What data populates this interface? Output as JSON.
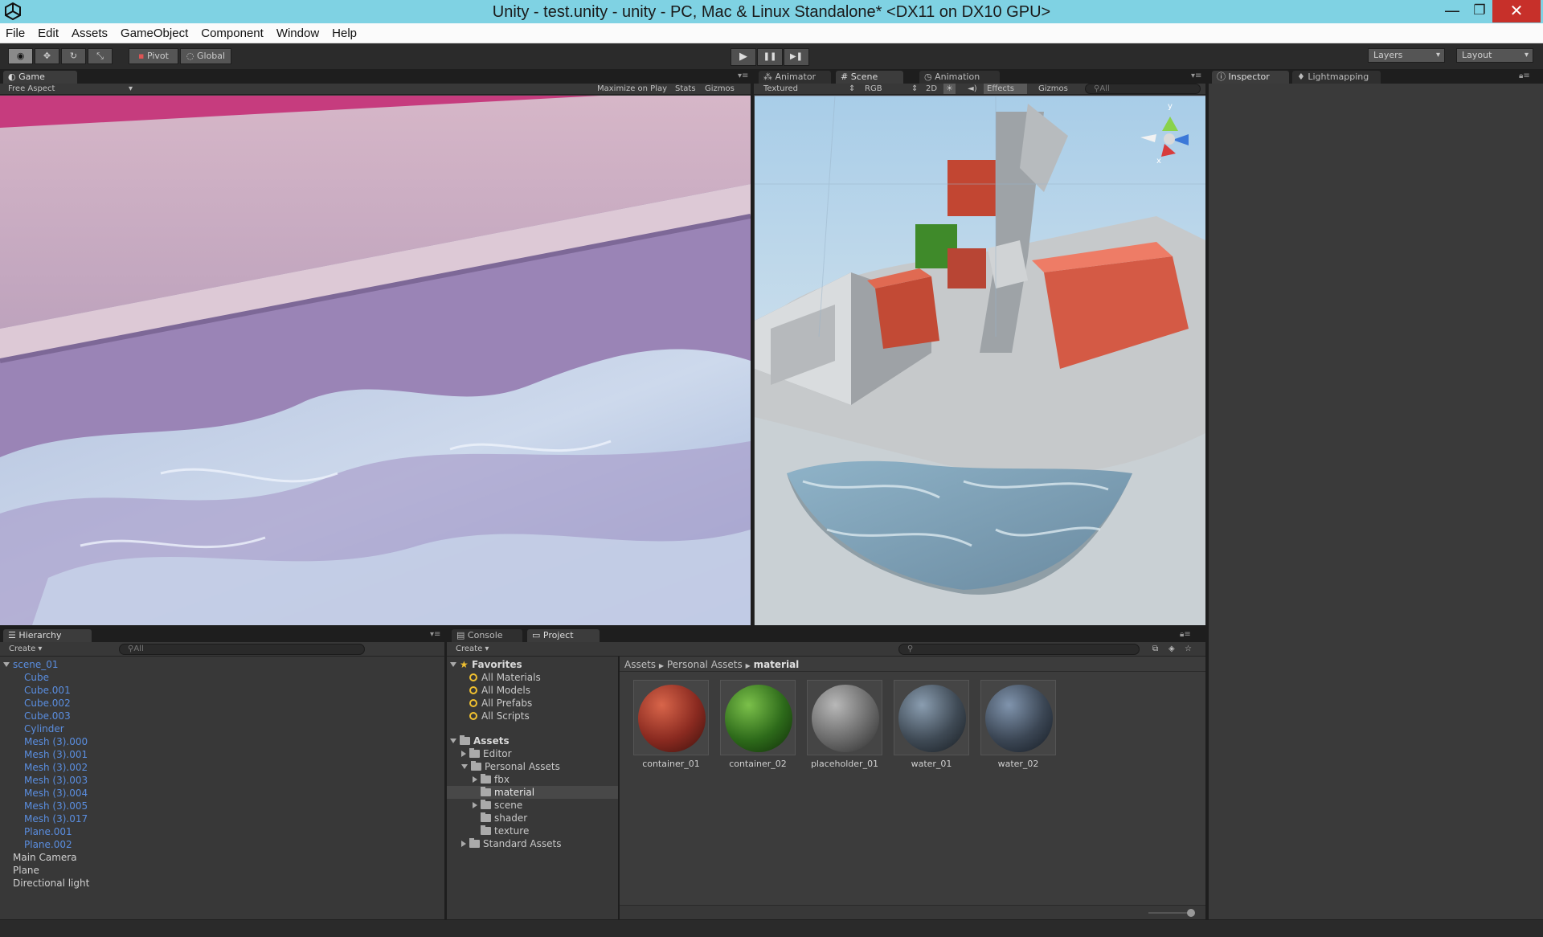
{
  "window": {
    "title": "Unity - test.unity - unity - PC, Mac & Linux Standalone* <DX11 on DX10 GPU>",
    "minimize": "—",
    "maximize": "❐",
    "close": "✕"
  },
  "menu": [
    "File",
    "Edit",
    "Assets",
    "GameObject",
    "Component",
    "Window",
    "Help"
  ],
  "toolbar": {
    "pivot": "Pivot",
    "global": "Global",
    "play": "▶",
    "pause": "❚❚",
    "step": "▶❚",
    "layers": "Layers",
    "layout": "Layout"
  },
  "game": {
    "tab": "Game",
    "aspect": "Free Aspect",
    "maximize_on_play": "Maximize on Play",
    "stats": "Stats",
    "gizmos": "Gizmos"
  },
  "scene": {
    "tabs": [
      "Animator",
      "Scene",
      "Animation"
    ],
    "shading": "Textured",
    "render": "RGB",
    "mode_2d": "2D",
    "effects": "Effects",
    "gizmos": "Gizmos",
    "search_placeholder": "All",
    "axis_y": "y",
    "axis_x": "x"
  },
  "inspector": {
    "tabs": [
      "Inspector",
      "Lightmapping"
    ]
  },
  "hierarchy": {
    "tab": "Hierarchy",
    "create": "Create",
    "search_placeholder": "All",
    "root": "scene_01",
    "children": [
      "Cube",
      "Cube.001",
      "Cube.002",
      "Cube.003",
      "Cylinder",
      "Mesh (3).000",
      "Mesh (3).001",
      "Mesh (3).002",
      "Mesh (3).003",
      "Mesh (3).004",
      "Mesh (3).005",
      "Mesh (3).017",
      "Plane.001",
      "Plane.002"
    ],
    "others": [
      "Main Camera",
      "Plane",
      "Directional light"
    ]
  },
  "project": {
    "tabs": [
      "Console",
      "Project"
    ],
    "create": "Create",
    "favorites_label": "Favorites",
    "favorites": [
      "All Materials",
      "All Models",
      "All Prefabs",
      "All Scripts"
    ],
    "assets_label": "Assets",
    "tree": [
      "Editor",
      "Personal Assets",
      "fbx",
      "material",
      "scene",
      "shader",
      "texture",
      "Standard Assets"
    ],
    "breadcrumb": [
      "Assets",
      "Personal Assets",
      "material"
    ],
    "assets": [
      {
        "name": "container_01",
        "color": "#8a2a20"
      },
      {
        "name": "container_02",
        "color": "#2d6a1a"
      },
      {
        "name": "placeholder_01",
        "color": "#7a7a7a"
      },
      {
        "name": "water_01",
        "color": "#3f4a55"
      },
      {
        "name": "water_02",
        "color": "#3b4654"
      }
    ]
  },
  "colors": {
    "titlebar": "#7fd2e3",
    "hierarchy_blue": "#5a8ee0",
    "panel_bg": "#383838"
  }
}
